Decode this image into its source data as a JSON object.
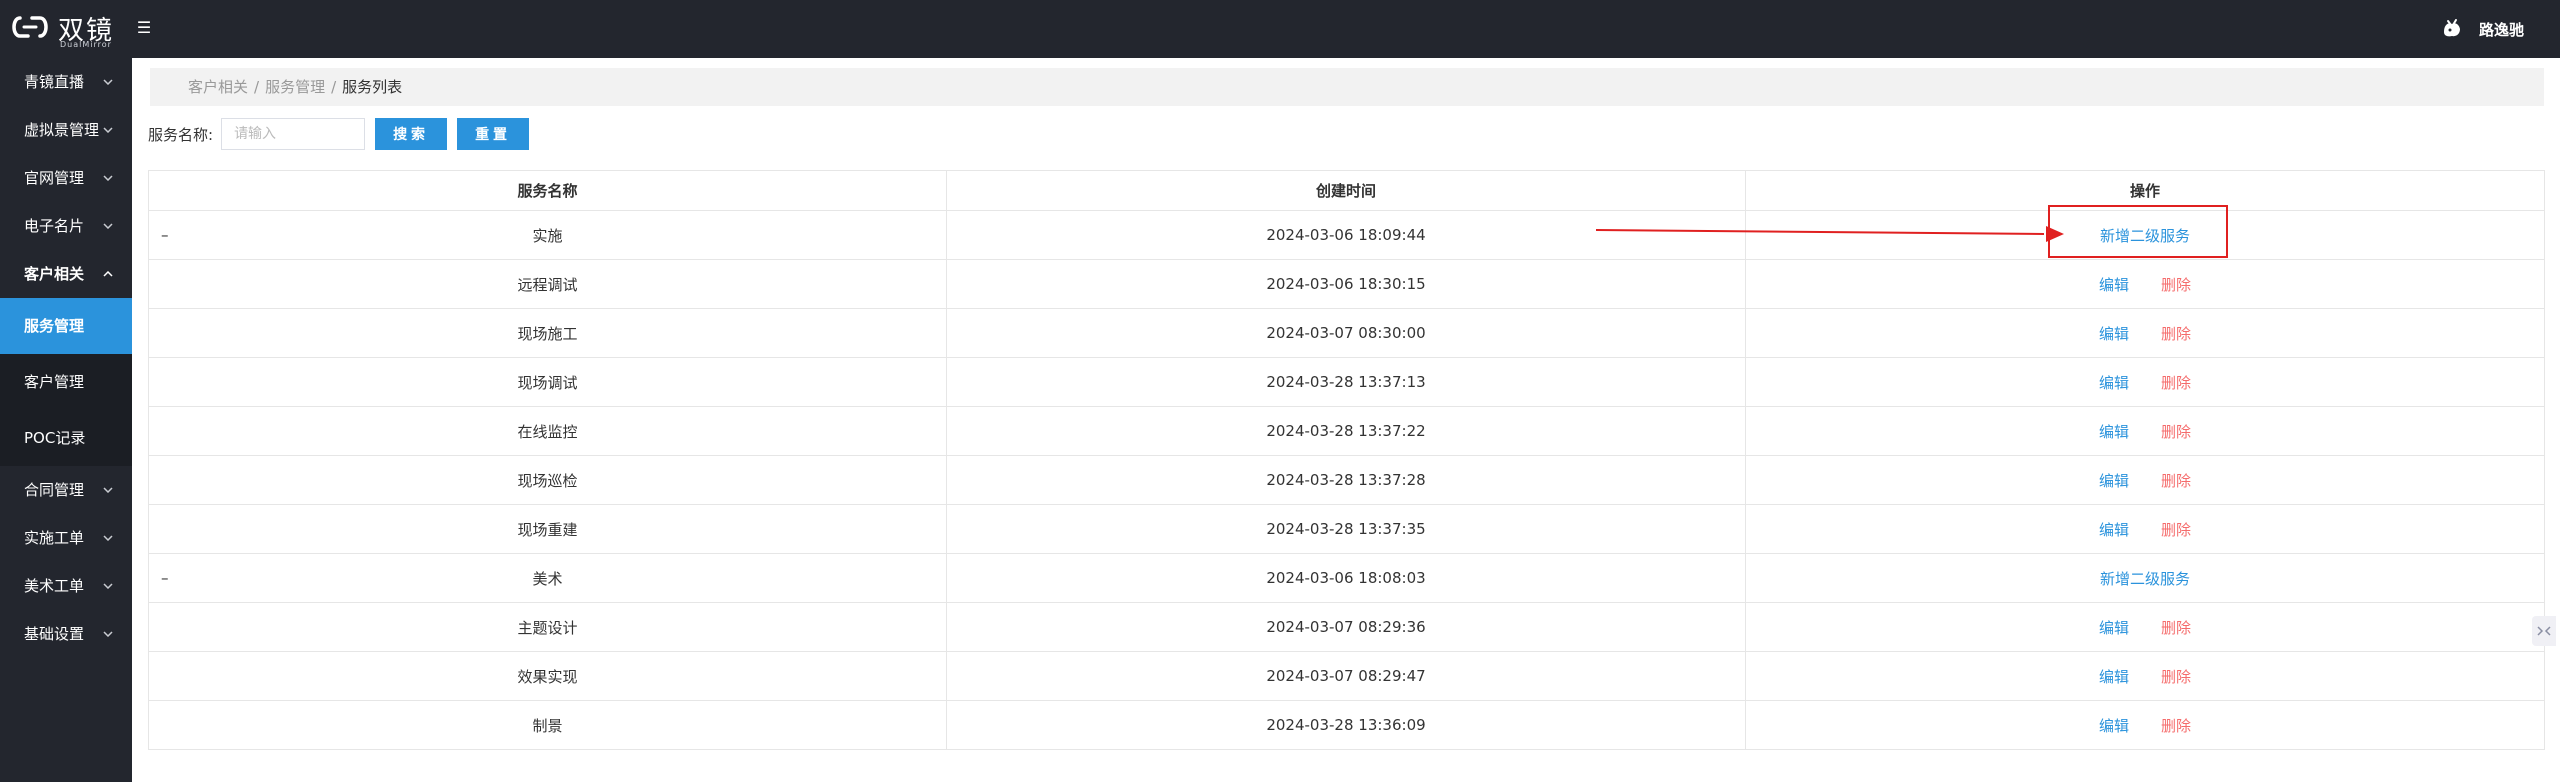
{
  "app": {
    "logo_text": "双镜",
    "logo_sub": "DualMirror",
    "user_name": "路逸驰"
  },
  "sidebar": {
    "items": [
      {
        "label": "青镜直播",
        "expanded": false
      },
      {
        "label": "虚拟景管理",
        "expanded": false
      },
      {
        "label": "官网管理",
        "expanded": false
      },
      {
        "label": "电子名片",
        "expanded": false
      },
      {
        "label": "客户相关",
        "expanded": true,
        "children": [
          {
            "label": "服务管理",
            "active": true
          },
          {
            "label": "客户管理",
            "active": false
          },
          {
            "label": "POC记录",
            "active": false
          }
        ]
      },
      {
        "label": "合同管理",
        "expanded": false
      },
      {
        "label": "实施工单",
        "expanded": false
      },
      {
        "label": "美术工单",
        "expanded": false
      },
      {
        "label": "基础设置",
        "expanded": false
      }
    ]
  },
  "breadcrumb": {
    "items": [
      "客户相关",
      "服务管理",
      "服务列表"
    ]
  },
  "search": {
    "label": "服务名称:",
    "placeholder": "请输入",
    "value": "",
    "search_button": "搜索",
    "reset_button": "重置"
  },
  "table": {
    "columns": [
      "服务名称",
      "创建时间",
      "操作"
    ],
    "rows": [
      {
        "name": "实施",
        "time": "2024-03-06 18:09:44",
        "level": 1,
        "expander": "–",
        "action": "新增二级服务"
      },
      {
        "name": "远程调试",
        "time": "2024-03-06 18:30:15",
        "level": 2,
        "edit": "编辑",
        "delete": "删除"
      },
      {
        "name": "现场施工",
        "time": "2024-03-07 08:30:00",
        "level": 2,
        "edit": "编辑",
        "delete": "删除"
      },
      {
        "name": "现场调试",
        "time": "2024-03-28 13:37:13",
        "level": 2,
        "edit": "编辑",
        "delete": "删除"
      },
      {
        "name": "在线监控",
        "time": "2024-03-28 13:37:22",
        "level": 2,
        "edit": "编辑",
        "delete": "删除"
      },
      {
        "name": "现场巡检",
        "time": "2024-03-28 13:37:28",
        "level": 2,
        "edit": "编辑",
        "delete": "删除"
      },
      {
        "name": "现场重建",
        "time": "2024-03-28 13:37:35",
        "level": 2,
        "edit": "编辑",
        "delete": "删除"
      },
      {
        "name": "美术",
        "time": "2024-03-06 18:08:03",
        "level": 1,
        "expander": "–",
        "action": "新增二级服务"
      },
      {
        "name": "主题设计",
        "time": "2024-03-07 08:29:36",
        "level": 2,
        "edit": "编辑",
        "delete": "删除"
      },
      {
        "name": "效果实现",
        "time": "2024-03-07 08:29:47",
        "level": 2,
        "edit": "编辑",
        "delete": "删除"
      },
      {
        "name": "制景",
        "time": "2024-03-28 13:36:09",
        "level": 2,
        "edit": "编辑",
        "delete": "删除"
      }
    ]
  },
  "colors": {
    "topbar": "#23262e",
    "accent": "#2b93dc",
    "danger": "#f56c6c",
    "annotation": "#e02020"
  },
  "icons": {
    "menu_toggle": "list-icon",
    "chevron": "chevron-down-icon",
    "chevron_open": "chevron-up-icon"
  }
}
